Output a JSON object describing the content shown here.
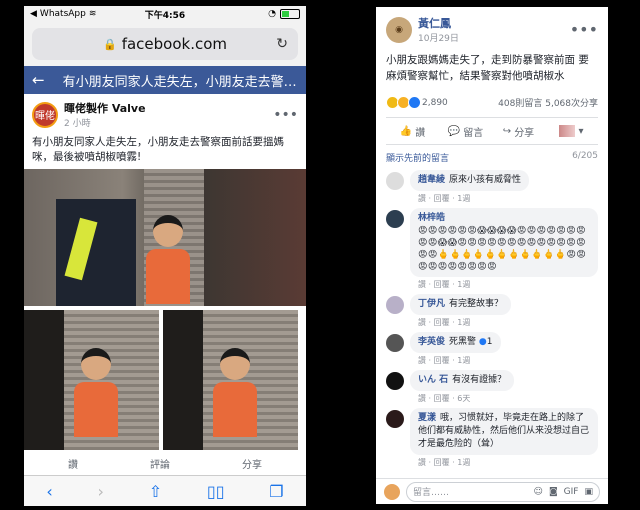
{
  "left": {
    "status": {
      "carrier": "WhatsApp",
      "time": "下午4:56"
    },
    "url": "facebook.com",
    "header_title": "有小朋友同家人走失左，小朋友走去警察...",
    "post": {
      "author": "暉佬製作 Valve",
      "time": "2 小時",
      "text": "有小朋友同家人走失左，小朋友走去警察面前話要搵媽咪，最後被噴胡椒噴霧!",
      "actions": [
        "讚",
        "評論",
        "分享"
      ]
    },
    "avatar_text": "暉佬",
    "colors": {
      "fb_blue": "#3b5998",
      "safari_blue": "#1a73e8"
    }
  },
  "right": {
    "author": "黃仁鳳",
    "date": "10月29日",
    "text": "小朋友跟媽媽走失了，走到防暴警察前面 要麻煩警察幫忙，結果警察對他噴胡椒水",
    "reaction_count": "2,890",
    "comment_count": "408則留言",
    "share_count": "5,068次分享",
    "actions": {
      "like": "讚",
      "comment": "留言",
      "share": "分享"
    },
    "prev_comments": "顯示先前的留言",
    "comment_progress": "6/205",
    "comments": [
      {
        "name": "趙韋綾",
        "text": "原來小孩有威脅性",
        "meta": "讚 · 回覆 · 1週"
      },
      {
        "name": "林梓皓",
        "text": "😡😡😡😡😡😡😱😱😱😱😡😡😡😡😡😡😡😡😡😱😱😡😡😡😡😡😡😡😡😡😡😡😡😡😡😡🖕🖕🖕🖕🖕🖕🖕🖕🖕🖕🖕😡😡😡😡😡😡😡😡😡😡",
        "meta": "讚 · 回覆 · 1週"
      },
      {
        "name": "丁伊凡",
        "text": "有完整故事？",
        "meta": "讚 · 回覆 · 1週"
      },
      {
        "name": "李英俊",
        "text": "死黑警",
        "likes": "1",
        "meta": "讚 · 回覆 · 1週"
      },
      {
        "name": "いん 石",
        "text": "有沒有證據？",
        "meta": "讚 · 回覆 · 6天"
      },
      {
        "name": "夏漾",
        "text": "哦，习惯就好，毕竟走在路上的除了他们都有威胁性，然后他们从来没想过自己才是最危险的（耸）",
        "meta": "讚 · 回覆 · 1週"
      }
    ],
    "input_placeholder": "留言……"
  }
}
